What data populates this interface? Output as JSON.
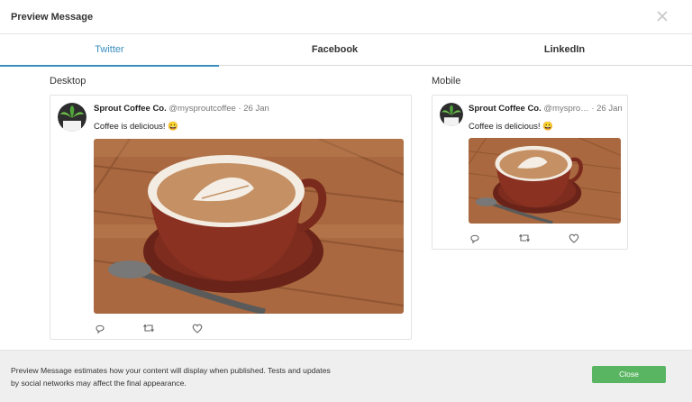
{
  "modal": {
    "title": "Preview Message"
  },
  "tabs": [
    {
      "label": "Twitter",
      "active": true
    },
    {
      "label": "Facebook",
      "active": false
    },
    {
      "label": "LinkedIn",
      "active": false
    }
  ],
  "desktop": {
    "section_label": "Desktop",
    "account_name": "Sprout Coffee Co.",
    "handle": "@mysproutcoffee",
    "date": "· 26 Jan",
    "text": "Coffee is delicious! 😀"
  },
  "mobile": {
    "section_label": "Mobile",
    "account_name": "Sprout Coffee Co.",
    "handle": "@myspro…",
    "date": "· 26 Jan",
    "text": "Coffee is delicious! 😀"
  },
  "icons": [
    "close-icon",
    "reply-icon",
    "retweet-icon",
    "like-icon"
  ],
  "footer": {
    "note": "Preview Message estimates how your content will display when published. Tests and updates by social networks may affect the final appearance.",
    "close_label": "Close"
  },
  "colors": {
    "accent": "#3a8dbd",
    "close_button": "#59b562"
  }
}
